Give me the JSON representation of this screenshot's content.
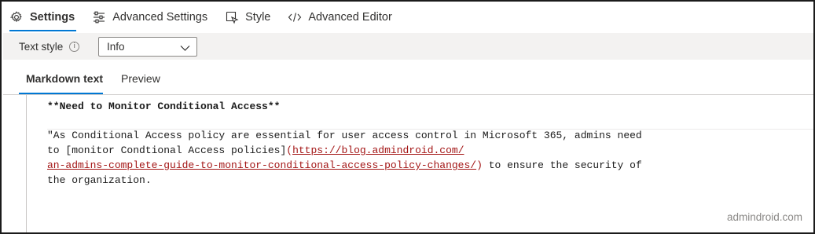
{
  "tabs": [
    {
      "label": "Settings",
      "icon": "gear-icon",
      "active": true
    },
    {
      "label": "Advanced Settings",
      "icon": "sliders-icon",
      "active": false
    },
    {
      "label": "Style",
      "icon": "style-icon",
      "active": false
    },
    {
      "label": "Advanced Editor",
      "icon": "code-icon",
      "active": false
    }
  ],
  "text_style": {
    "label": "Text style",
    "info_glyph": "i",
    "selected": "Info"
  },
  "subtabs": [
    {
      "label": "Markdown text",
      "active": true
    },
    {
      "label": "Preview",
      "active": false
    }
  ],
  "editor": {
    "line1": "**Need to Monitor Conditional Access**",
    "line2": "\"As Conditional Access policy are essential for user access control in Microsoft 365, admins need",
    "line3_prefix": "to [monitor Condtional Access policies]",
    "line3_paren_open": "(",
    "line3_url": "https://blog.admindroid.com/",
    "line4_url": "an-admins-complete-guide-to-monitor-conditional-access-policy-changes/",
    "line4_paren_close": ")",
    "line4_suffix": " to ensure the security of",
    "line5": "the organization."
  },
  "watermark": "admindroid.com",
  "colors": {
    "accent": "#0078d4",
    "link": "#a31515",
    "bar_bg": "#f3f2f1"
  }
}
